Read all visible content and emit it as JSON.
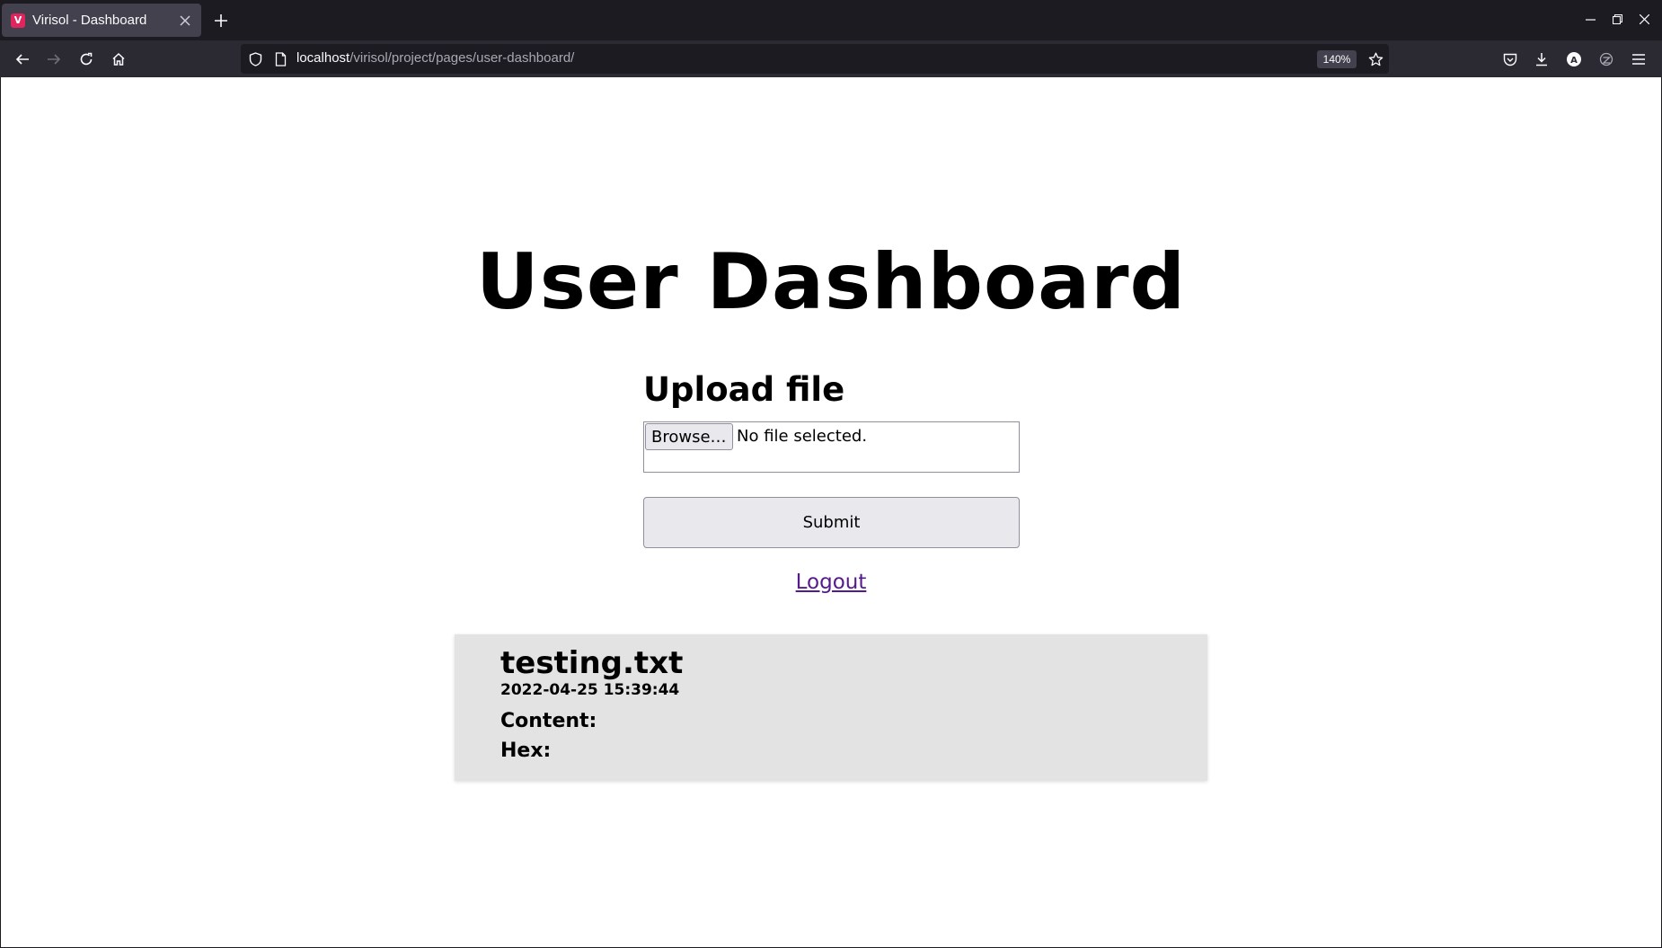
{
  "browser": {
    "tab_title": "Virisol - Dashboard",
    "tab_favicon_letter": "V",
    "url_host": "localhost",
    "url_path": "/virisol/project/pages/user-dashboard/",
    "zoom_level": "140%"
  },
  "icons": {
    "back": "back-arrow-icon",
    "forward": "forward-arrow-icon",
    "reload": "reload-icon",
    "home": "home-icon",
    "shield": "tracking-protection-shield-icon",
    "page": "page-info-icon",
    "bookmark": "bookmark-star-icon",
    "pocket": "pocket-icon",
    "downloads": "downloads-icon",
    "account": "account-icon",
    "extensions": "extension-icon",
    "menu": "hamburger-menu-icon"
  },
  "page": {
    "title": "User Dashboard",
    "upload_heading": "Upload file",
    "browse_label": "Browse…",
    "no_file_text": "No file selected.",
    "submit_label": "Submit",
    "logout_label": "Logout"
  },
  "files": [
    {
      "name": "testing.txt",
      "timestamp": "2022-04-25 15:39:44",
      "content_label": "Content:",
      "hex_label": "Hex:"
    }
  ],
  "colors": {
    "link_visited": "#551a8b",
    "card_background": "#e3e3e3",
    "chrome_dark": "#1c1b22",
    "toolbar": "#2b2a33"
  }
}
